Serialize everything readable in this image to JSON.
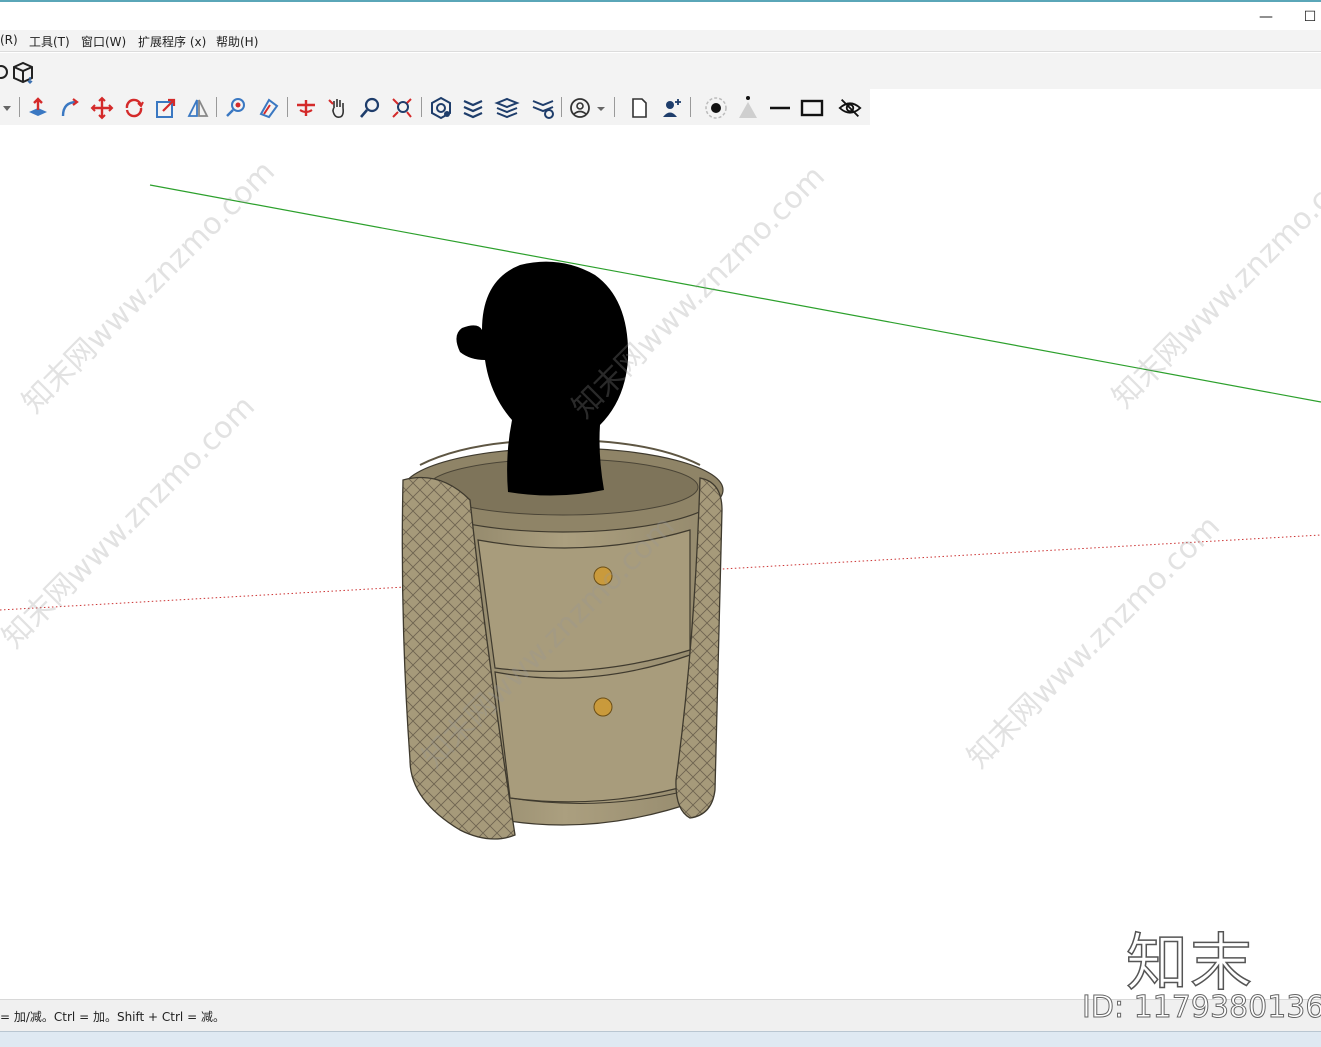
{
  "menu": {
    "items": [
      "(R)",
      "工具(T)",
      "窗口(W)",
      "扩展程序 (x)",
      "帮助(H)"
    ]
  },
  "window": {
    "minimize_glyph": "—",
    "maximize_glyph": "☐"
  },
  "toolbar_primary": {
    "icons": [
      "orbit-icon",
      "component-box-icon"
    ]
  },
  "toolbar_secondary": {
    "icons": [
      "dropdown-arrow-icon",
      "push-pull-icon",
      "follow-me-icon",
      "move-icon",
      "rotate-icon",
      "scale-icon",
      "flip-icon",
      "zoom-window-icon",
      "paint-icon",
      "section-plane-icon",
      "pan-icon",
      "zoom-icon",
      "zoom-extents-icon",
      "styles-icon",
      "layers-icon",
      "tags-icon",
      "tag-settings-icon",
      "user-account-icon",
      "new-document-icon",
      "add-user-icon",
      "point-icon",
      "cone-icon",
      "line-icon",
      "rectangle-icon",
      "hide-icon"
    ]
  },
  "scene": {
    "object": "round nightstand with quilted side panels and two drawers",
    "head_silhouette": "black head silhouette",
    "axis_colors": {
      "green": "#2ca02c",
      "red": "#cc3333"
    },
    "furniture_color": "#a69a7a",
    "knob_color": "#c99a3c"
  },
  "status": {
    "hint": "= 加/减。Ctrl = 加。Shift + Ctrl = 减。"
  },
  "branding": {
    "logo_text": "知末",
    "id_text": "ID: 1179380136",
    "watermark": "知末网www.znzmo.com"
  }
}
